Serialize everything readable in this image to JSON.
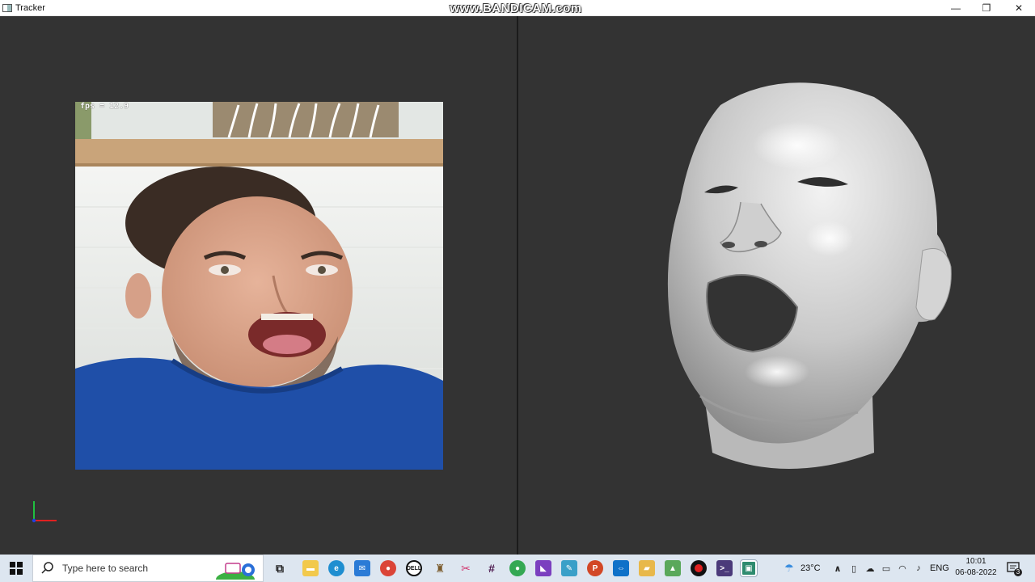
{
  "window": {
    "title": "Tracker",
    "watermark": "www.BANDICAM.com",
    "controls": {
      "minimize": "—",
      "maximize": "❐",
      "close": "✕"
    }
  },
  "left_viewport": {
    "camera_feed": {
      "fps_label": "fps = 12.9"
    },
    "axis_gizmo": {
      "x_color": "#e02020",
      "y_color": "#20c040",
      "z_color": "#2040e0"
    }
  },
  "right_viewport": {
    "model": "3d-face-mesh",
    "mesh_color": "#c9c9c9"
  },
  "colors": {
    "viewport_bg": "#333333",
    "taskbar_bg": "#dde6f0"
  },
  "taskbar": {
    "search_placeholder": "Type here to search",
    "pinned_apps": [
      "task-view-icon",
      "file-explorer-icon",
      "edge-icon",
      "mail-icon",
      "chrome-icon",
      "dell-icon",
      "microscope-icon",
      "snipping-tool-icon",
      "slack-icon",
      "chrome-icon",
      "visual-studio-icon",
      "notepad-icon",
      "powerpoint-icon",
      "teamviewer-icon",
      "folder-app-icon",
      "image-app-icon",
      "record-icon",
      "terminal-icon",
      "tracker-app-icon"
    ],
    "tray": {
      "weather": "23°C",
      "language": "ENG",
      "time": "10:01",
      "date": "06-08-2022",
      "notification_count": "3"
    }
  }
}
